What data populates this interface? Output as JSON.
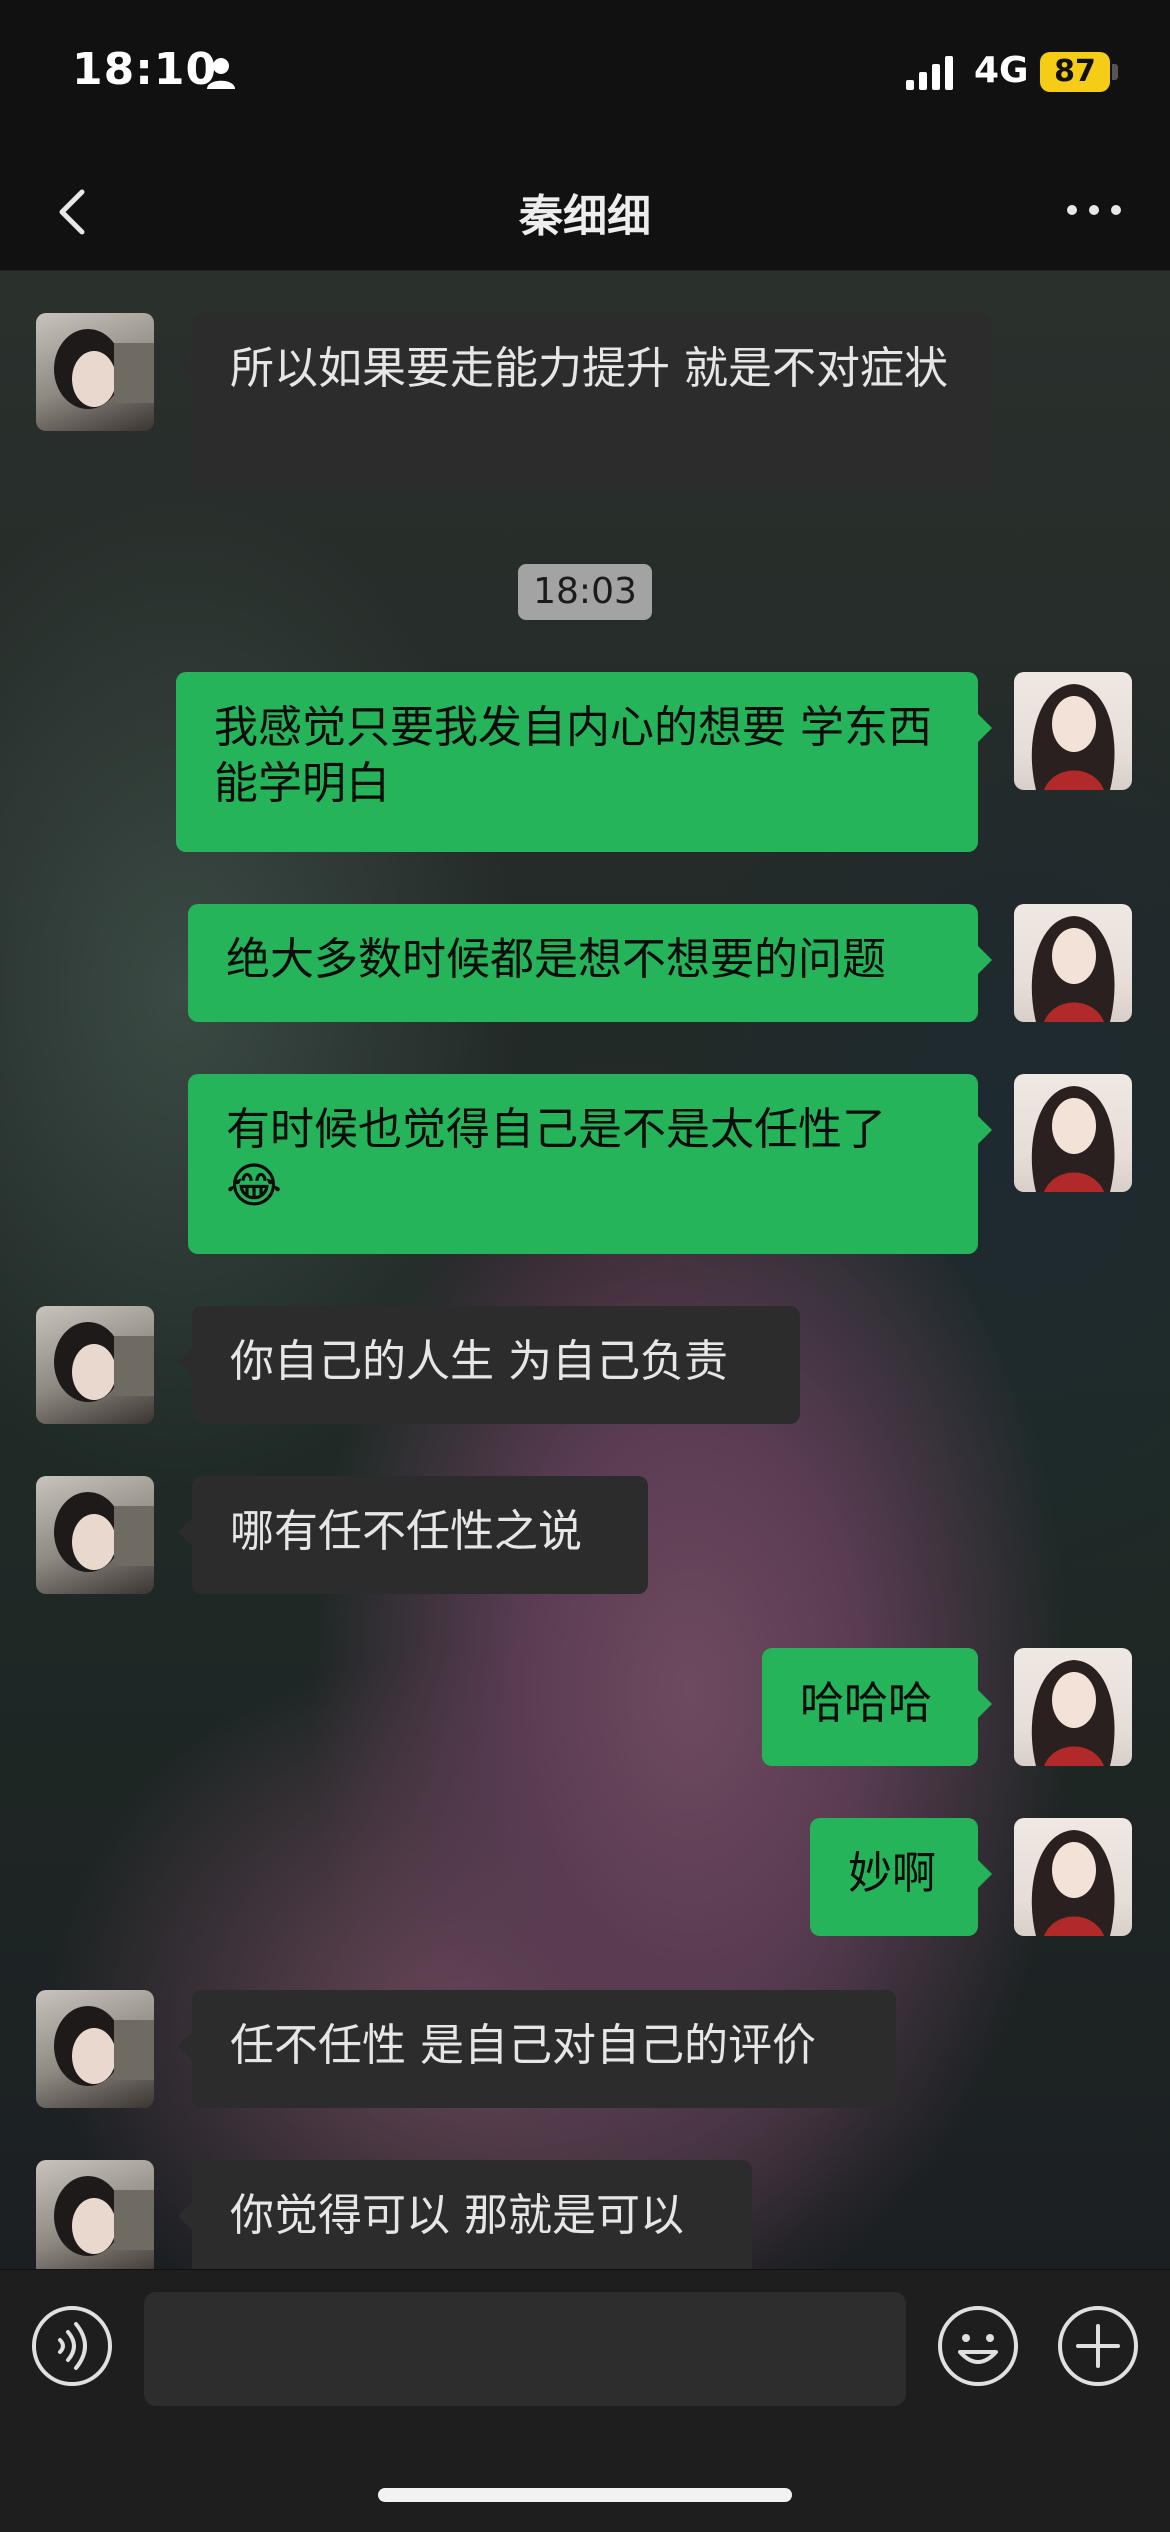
{
  "status_bar": {
    "time": "18:10",
    "network": "4G",
    "battery": "87"
  },
  "header": {
    "title": "秦细细"
  },
  "messages": [
    {
      "from": "friend",
      "text": "所以如果要走能力提升 就是不对症状"
    },
    {
      "timestamp": "18:03"
    },
    {
      "from": "me",
      "text": "我感觉只要我发自内心的想要 学东西能学明白"
    },
    {
      "from": "me",
      "text": "绝大多数时候都是想不想要的问题"
    },
    {
      "from": "me",
      "text": "有时候也觉得自己是不是太任性了",
      "emoji": "😂"
    },
    {
      "from": "friend",
      "text": "你自己的人生 为自己负责"
    },
    {
      "from": "friend",
      "text": "哪有任不任性之说"
    },
    {
      "from": "me",
      "text": "哈哈哈"
    },
    {
      "from": "me",
      "text": "妙啊"
    },
    {
      "from": "friend",
      "text": "任不任性 是自己对自己的评价"
    },
    {
      "from": "friend",
      "text": "你觉得可以 那就是可以"
    }
  ],
  "icons": {
    "back": "chevron-left-icon",
    "more": "ellipsis-icon",
    "voice": "voice-icon",
    "emoji": "emoji-icon",
    "plus": "plus-icon"
  },
  "colors": {
    "outgoing_bubble": "#26b45a",
    "incoming_bubble": "#2c2c2c",
    "battery": "#f5cc16"
  }
}
